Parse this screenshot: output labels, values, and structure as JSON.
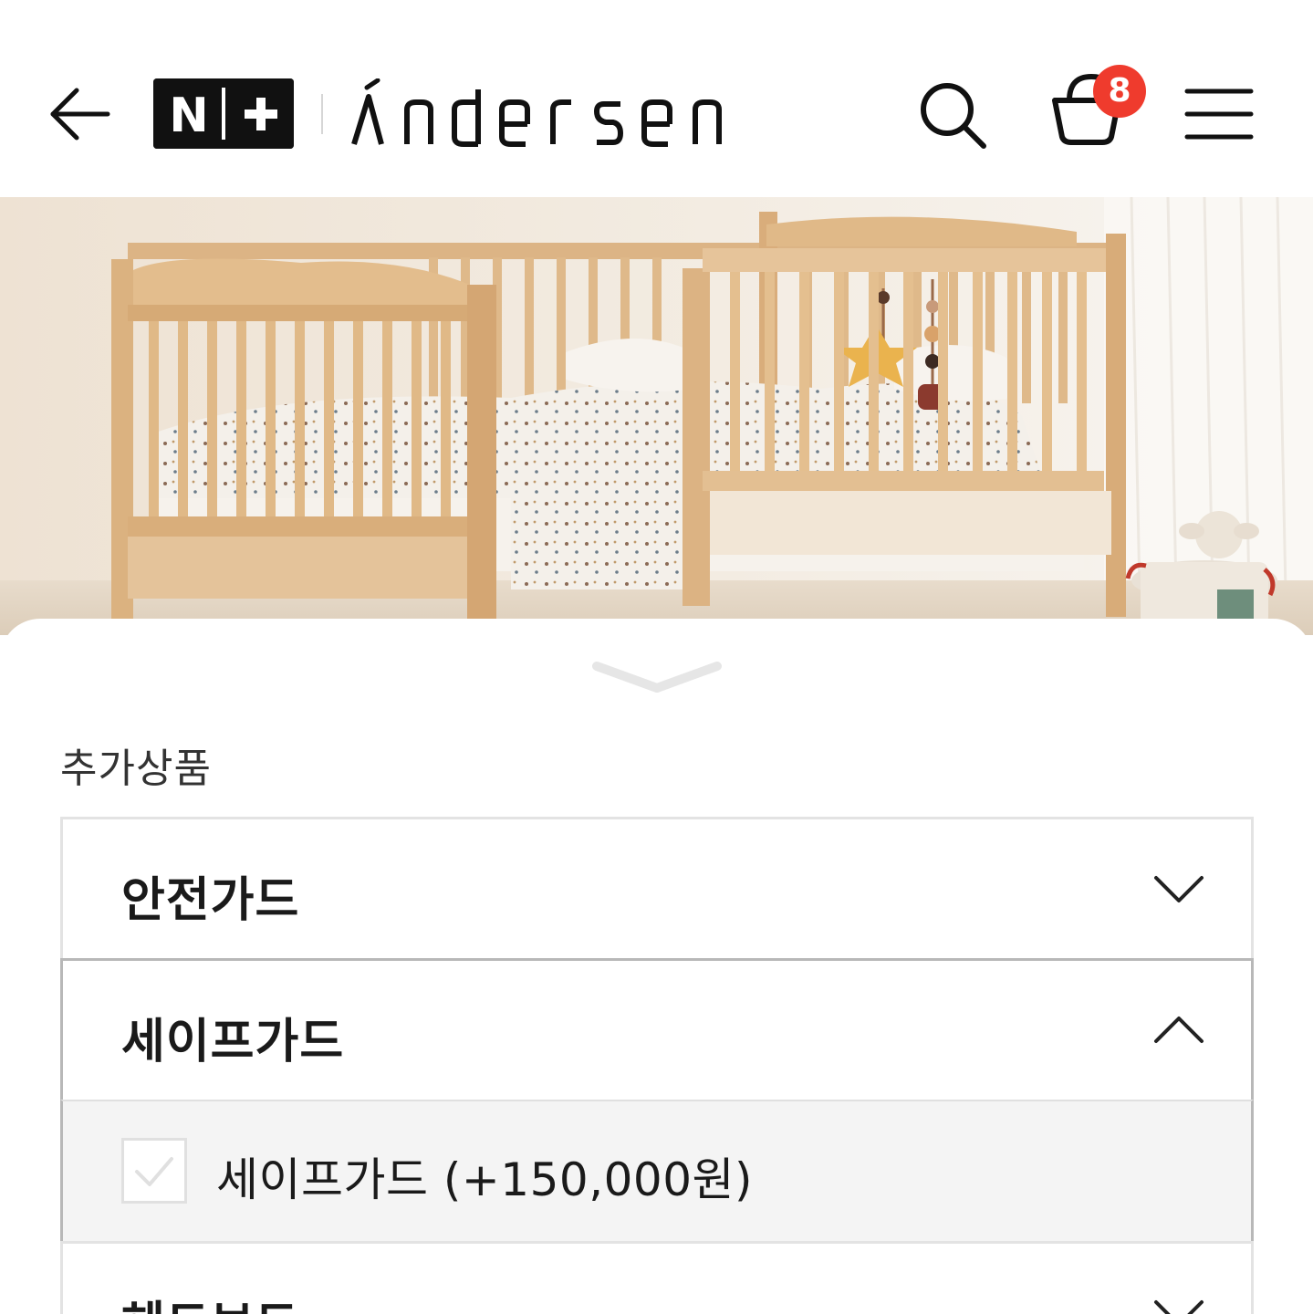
{
  "header": {
    "back_icon": "arrow-left-icon",
    "nplus_logo": "N+",
    "brand_logo": "andersen",
    "search_icon": "search-icon",
    "cart_icon": "shopping-basket-icon",
    "cart_count": "8",
    "menu_icon": "hamburger-menu-icon"
  },
  "hero": {
    "image_subject": "wooden toddler bed with safety guard rails"
  },
  "sheet": {
    "handle_icon": "chevron-down-icon",
    "section_title": "추가상품",
    "options": [
      {
        "label": "안전가드",
        "state": "collapsed",
        "icon": "chevron-down-icon"
      },
      {
        "label": "세이프가드",
        "state": "expanded",
        "icon": "chevron-up-icon"
      },
      {
        "label": "헤드보드",
        "state": "collapsed",
        "icon": "chevron-down-icon"
      }
    ],
    "expanded_items": [
      {
        "label": "세이프가드 (+150,000원)",
        "checked": false
      }
    ]
  },
  "colors": {
    "badge": "#ef3b2d",
    "wood": "#e0b987",
    "wall": "#efe5d8"
  }
}
